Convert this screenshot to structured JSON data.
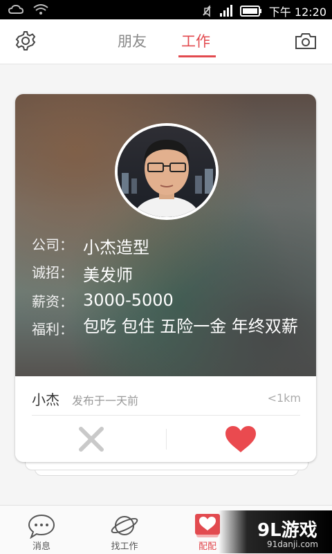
{
  "status_bar": {
    "time_label": "下午 12:20",
    "icons": [
      "cloud-icon",
      "wifi-icon",
      "mute-icon",
      "signal-icon",
      "battery-icon"
    ]
  },
  "top_bar": {
    "tabs": [
      {
        "label": "朋友",
        "active": false
      },
      {
        "label": "工作",
        "active": true
      }
    ],
    "left_icon": "gear-icon",
    "right_icon": "camera-icon",
    "accent_color": "#e24a4f"
  },
  "job_card": {
    "fields": [
      {
        "label": "公司：",
        "value": "小杰造型"
      },
      {
        "label": "诚招：",
        "value": "美发师"
      },
      {
        "label": "薪资：",
        "value": "3000-5000"
      },
      {
        "label": "福利：",
        "value": "包吃 包住 五险一金 年终双薪"
      }
    ],
    "author": "小杰",
    "posted_text": "发布于一天前",
    "distance": "<1km",
    "actions": {
      "dislike_icon": "close-icon",
      "like_icon": "heart-icon"
    }
  },
  "bottom_nav": {
    "items": [
      {
        "label": "消息",
        "icon": "chat-bubble-icon"
      },
      {
        "label": "找工作",
        "icon": "planet-icon"
      },
      {
        "label": "配配",
        "icon": "card-heart-icon",
        "active": true
      }
    ]
  },
  "watermark": {
    "logo": "9L游戏",
    "url": "91danji.com"
  }
}
